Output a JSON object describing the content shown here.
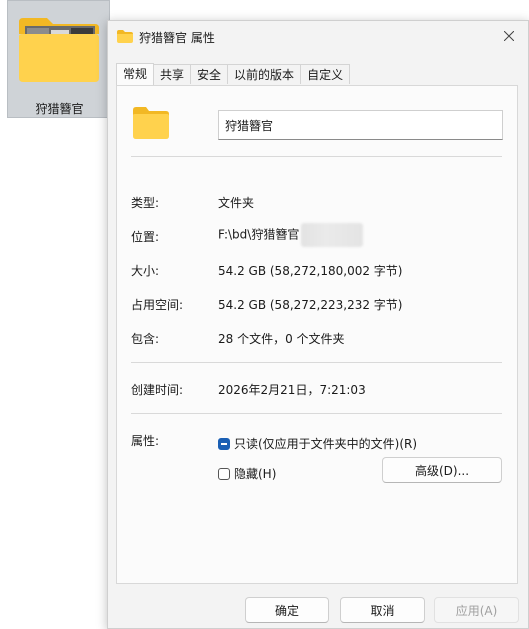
{
  "desktop": {
    "folder_label": "狩猎簪官"
  },
  "dialog": {
    "title": "狩猎簪官 属性",
    "tabs": [
      {
        "label": "常规",
        "active": true
      },
      {
        "label": "共享",
        "active": false
      },
      {
        "label": "安全",
        "active": false
      },
      {
        "label": "以前的版本",
        "active": false
      },
      {
        "label": "自定义",
        "active": false
      }
    ],
    "name_value": "狩猎簪官",
    "fields": {
      "type_label": "类型:",
      "type_value": "文件夹",
      "location_label": "位置:",
      "location_value": "F:\\bd\\狩猎簪官",
      "size_label": "大小:",
      "size_value": "54.2 GB (58,272,180,002 字节)",
      "disk_size_label": "占用空间:",
      "disk_size_value": "54.2 GB (58,272,223,232 字节)",
      "contains_label": "包含:",
      "contains_value": "28 个文件，0 个文件夹",
      "created_label": "创建时间:",
      "created_value": "2026年2月21日，7:21:03",
      "attributes_label": "属性:"
    },
    "attributes": {
      "readonly_label": "只读(仅应用于文件夹中的文件)(R)",
      "readonly_state": "indeterminate",
      "hidden_label": "隐藏(H)",
      "hidden_checked": false,
      "advanced_label": "高级(D)..."
    },
    "buttons": {
      "ok": "确定",
      "cancel": "取消",
      "apply": "应用(A)"
    }
  },
  "colors": {
    "folder": "#ffd24d",
    "folder_dark": "#f2b824",
    "accent": "#1a5fb4"
  }
}
